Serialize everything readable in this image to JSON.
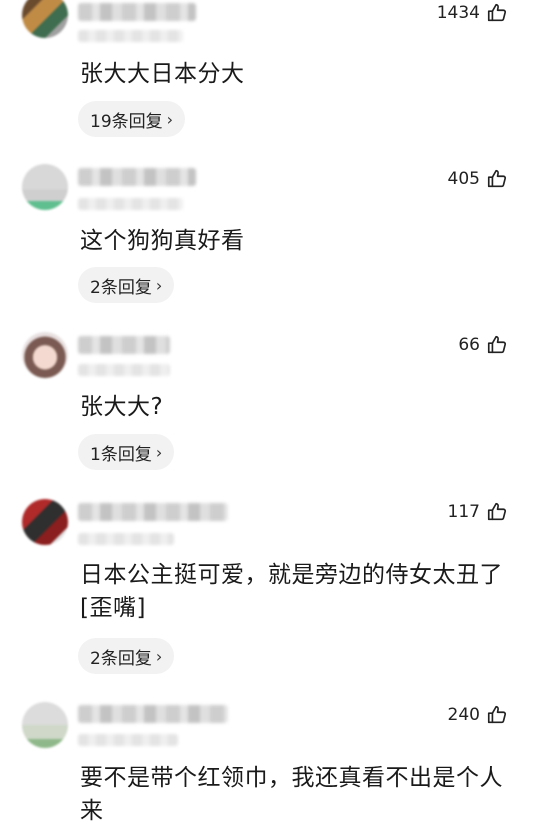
{
  "comments": [
    {
      "likes": "1434",
      "text": "张大大日本分大",
      "replies": "19条回复"
    },
    {
      "likes": "405",
      "text": "这个狗狗真好看",
      "replies": "2条回复"
    },
    {
      "likes": "66",
      "text": "张大大?",
      "replies": "1条回复"
    },
    {
      "likes": "117",
      "text": "日本公主挺可爱，就是旁边的侍女太丑了[歪嘴]",
      "replies": "2条回复"
    },
    {
      "likes": "240",
      "text": "要不是带个红领巾，我还真看不出是个人来",
      "replies": ""
    }
  ],
  "icons": {
    "like": "thumbs-up-icon",
    "more": "chevron-right-icon"
  },
  "colors": {
    "pill_bg": "#f2f2f2",
    "text": "#1a1a1a"
  }
}
